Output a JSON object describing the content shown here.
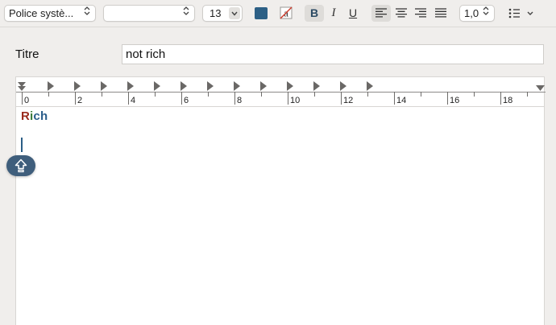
{
  "toolbar": {
    "font_family": "Police systè...",
    "font_style": "",
    "font_size": "13",
    "text_color": "#2c5f85",
    "bold_label": "B",
    "italic_label": "I",
    "underline_label": "U",
    "alignment_selected": "left",
    "line_spacing": "1,0",
    "list_icon": "list-bullets-icon"
  },
  "form": {
    "title_label": "Titre",
    "title_value": "not rich"
  },
  "ruler": {
    "labels": [
      "0",
      "2",
      "4",
      "6",
      "8",
      "10",
      "12",
      "14",
      "16",
      "18"
    ],
    "tab_stops_count": 13
  },
  "editor": {
    "content_parts": [
      "R",
      "i",
      "ch"
    ],
    "content_colors": [
      "#9a2a1c",
      "#3c7a3a",
      "#2a5d8a"
    ]
  },
  "overlay": {
    "icon": "shift-key-icon"
  }
}
